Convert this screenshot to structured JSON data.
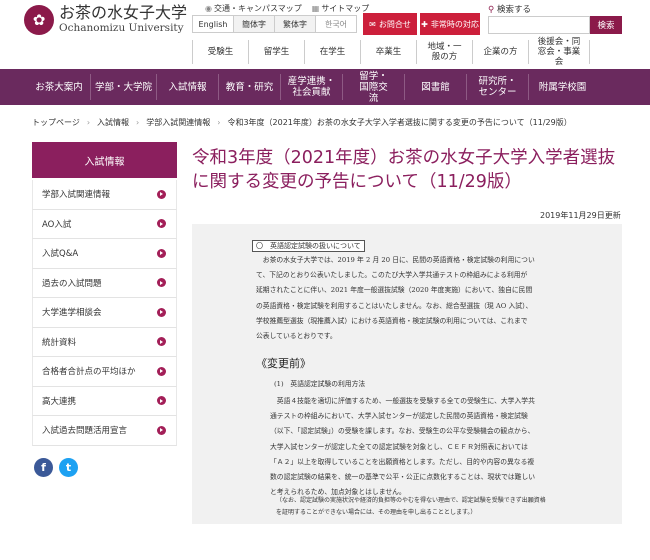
{
  "header": {
    "logo_text_jp": "お茶の水女子大学",
    "logo_text_en": "Ochanomizu University",
    "util_links": [
      {
        "label": "交通・キャンパスマップ"
      },
      {
        "label": "サイトマップ"
      }
    ],
    "languages": [
      "English",
      "簡体字",
      "繁体字",
      "한국어"
    ],
    "contact_label": "お問合せ",
    "emergency_label": "非常時の対応",
    "search_label": "検索する",
    "search_placeholder": "",
    "search_button": "検索"
  },
  "audience_nav": [
    "受験生",
    "留学生",
    "在学生",
    "卒業生",
    "地域・一般の方",
    "企業の方",
    "後援会・同窓会・事業会"
  ],
  "main_nav": [
    "お茶大案内",
    "学部・大学院",
    "入試情報",
    "教育・研究",
    "産学連携・社会貢献",
    "留学・国際交流",
    "図書館",
    "研究所・センター",
    "附属学校園"
  ],
  "breadcrumb": [
    "トップページ",
    "入試情報",
    "学部入試関連情報",
    "令和3年度（2021年度）お茶の水女子大学入学者選抜に関する変更の予告について（11/29版）"
  ],
  "sidebar": {
    "heading": "入試情報",
    "items": [
      {
        "label": "学部入試関連情報"
      },
      {
        "label": "AO入試"
      },
      {
        "label": "入試Q&A"
      },
      {
        "label": "過去の入試問題"
      },
      {
        "label": "大学進学相談会"
      },
      {
        "label": "統計資料"
      },
      {
        "label": "合格者合計点の平均ほか"
      },
      {
        "label": "高大連携"
      },
      {
        "label": "入試過去問題活用宣言"
      }
    ]
  },
  "social": {
    "facebook_glyph": "f",
    "twitter_glyph": "t"
  },
  "content": {
    "title": "令和3年度（2021年度）お茶の水女子大学入学者選抜に関する変更の予告について（11/29版）",
    "date": "2019年11月29日更新",
    "section_label": "〇　英語認定試験の扱いについて",
    "intro_lines": [
      "　お茶の水女子大学では、2019 年 2 月 20 日に、民間の英語資格・検定試験の利用につい",
      "て、下記のとおり公表いたしました。このたび大学入学共通テストの枠組みによる利用が",
      "延期されたことに伴い、2021 年度一般選抜試験（2020 年度実施）において、独自に民間",
      "の英語資格・検定試験を利用することはいたしません。なお、総合型選抜（現 AO 入試）、",
      "学校推薦型選抜（現推薦入試）における英語資格・検定試験の利用については、これまで",
      "公表しているとおりです。"
    ],
    "change_heading": "《変更前》",
    "sub_heading": "(1)　英語認定試験の利用方法",
    "body_lines": [
      "　英語４技能を適切に評価するため、一般選抜を受験する全ての受験生に、大学入学共",
      "通テストの枠組みにおいて、大学入試センターが認定した民間の英語資格・検定試験",
      "（以下、「認定試験」）の受験を課します。なお、受験生の公平な受験機会の観点から、",
      "大学入試センターが認定した全ての認定試験を対象とし、ＣＥＦＲ対照表においては",
      "「Ａ２」以上を取得していることを出願資格とします。ただし、目的や内容の異なる複",
      "数の認定試験の結果を、統一の基準で公平・公正に点数化することは、現状では難しい",
      "と考えられるため、加点対象とはしません。"
    ],
    "note_lines": [
      "（なお、認定試験の実施状況や経済的負担等のやむを得ない理由で、認定試験を受験できず出願資格",
      "を証明することができない場合には、その理由を申し出ることとします。）"
    ]
  },
  "colors": {
    "brand_purple": "#6a2a5e",
    "sidebar_head": "#8b1f5e",
    "title_color": "#8b1f5e",
    "accent_red": "#cc1f3b"
  }
}
